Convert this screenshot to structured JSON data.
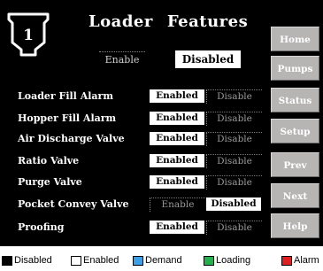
{
  "header": {
    "logo_number": "1",
    "title_word1": "Loader",
    "title_word2": "Features",
    "enable_label": "Enable",
    "disabled_label": "Disabled"
  },
  "features": [
    {
      "label": "Loader Fill Alarm",
      "enabled": "Enabled",
      "disable": "Disable",
      "state": "enabled"
    },
    {
      "label": "Hopper Fill Alarm",
      "enabled": "Enabled",
      "disable": "Disable",
      "state": "enabled"
    },
    {
      "label": "Air Discharge Valve",
      "enabled": "Enabled",
      "disable": "Disable",
      "state": "enabled"
    },
    {
      "label": "Ratio Valve",
      "enabled": "Enabled",
      "disable": "Disable",
      "state": "enabled"
    },
    {
      "label": "Purge Valve",
      "enabled": "Enabled",
      "disable": "Disable",
      "state": "enabled"
    },
    {
      "label": "Pocket Convey Valve",
      "enabled": "Enable",
      "disable": "Disabled",
      "state": "disabled"
    },
    {
      "label": "Proofing",
      "enabled": "Enabled",
      "disable": "Disable",
      "state": "enabled"
    }
  ],
  "nav": [
    "Home",
    "Pumps",
    "Status",
    "Setup",
    "Prev",
    "Next",
    "Help"
  ],
  "legend": [
    {
      "label": "Disabled",
      "color": "#000000"
    },
    {
      "label": "Enabled",
      "color": "#ffffff"
    },
    {
      "label": "Demand",
      "color": "#3aa0e8"
    },
    {
      "label": "Loading",
      "color": "#22b14c"
    },
    {
      "label": "Alarm",
      "color": "#e02020"
    }
  ]
}
